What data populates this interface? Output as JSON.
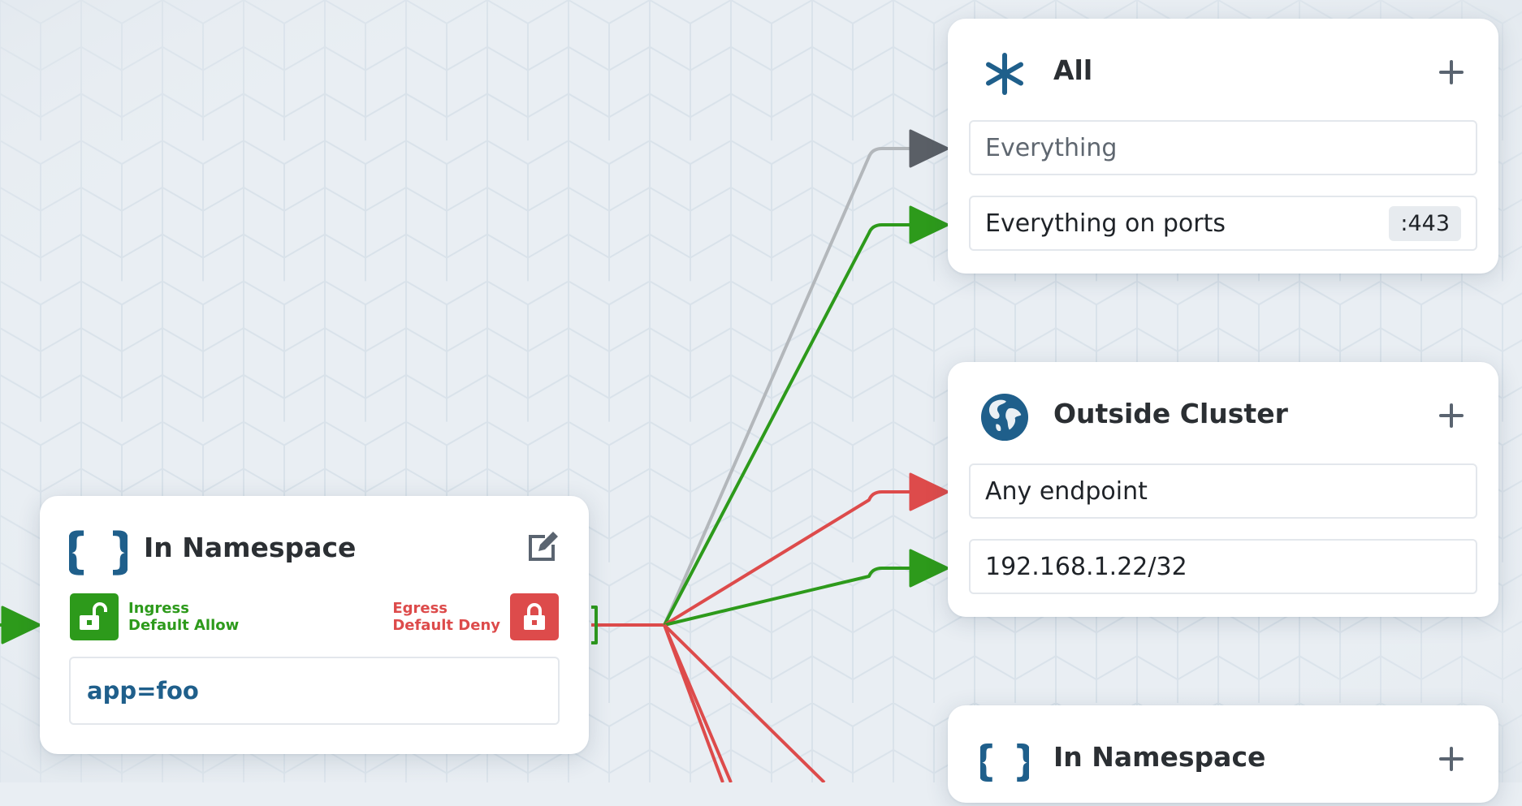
{
  "colors": {
    "allow": "#2d9a1b",
    "deny": "#dd4b4b",
    "neutral": "#5a5f66",
    "brand_blue": "#1f5f8b",
    "edge_gray": "#b3b7bb"
  },
  "source_node": {
    "icon": "braces-icon",
    "title": "In Namespace",
    "edit_icon": "edit-icon",
    "ingress": {
      "icon": "unlock-icon",
      "line1": "Ingress",
      "line2": "Default Allow"
    },
    "egress": {
      "icon": "lock-icon",
      "line1": "Egress",
      "line2": "Default Deny"
    },
    "selector_label": "app=foo"
  },
  "target_nodes": [
    {
      "icon": "asterisk-icon",
      "title": "All",
      "add_icon": "plus-icon",
      "rows": [
        {
          "text": "Everything",
          "muted": true,
          "edge": "neutral"
        },
        {
          "text": "Everything on ports",
          "port": ":443",
          "edge": "allow"
        }
      ]
    },
    {
      "icon": "globe-icon",
      "title": "Outside Cluster",
      "add_icon": "plus-icon",
      "rows": [
        {
          "text": "Any endpoint",
          "edge": "deny"
        },
        {
          "text": "192.168.1.22/32",
          "edge": "allow"
        }
      ]
    },
    {
      "icon": "braces-icon",
      "title": "In Namespace",
      "add_icon": "plus-icon",
      "rows": []
    }
  ]
}
